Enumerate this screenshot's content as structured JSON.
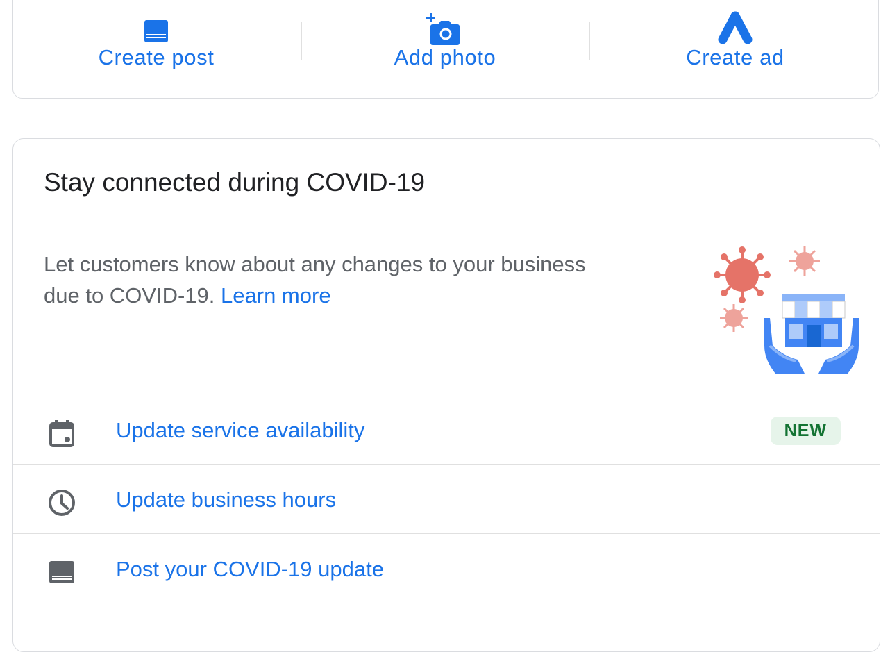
{
  "quick_actions": [
    {
      "label": "Create post",
      "icon": "post-icon"
    },
    {
      "label": "Add photo",
      "icon": "add-photo-icon"
    },
    {
      "label": "Create ad",
      "icon": "google-ads-icon"
    }
  ],
  "covid_card": {
    "title": "Stay connected during COVID-19",
    "description": "Let customers know about any changes to your business due to COVID-19.",
    "learn_more": "Learn more",
    "illustration": "covid-storefront-illustration",
    "items": [
      {
        "label": "Update service availability",
        "icon": "calendar-icon",
        "badge": "NEW"
      },
      {
        "label": "Update business hours",
        "icon": "clock-icon"
      },
      {
        "label": "Post your COVID-19 update",
        "icon": "post-icon"
      }
    ]
  },
  "colors": {
    "accent_blue": "#1a73e8",
    "text_dark": "#202124",
    "text_muted": "#5f6368",
    "badge_bg": "#e6f4ea",
    "badge_text": "#137333",
    "virus_red": "#e57368"
  }
}
